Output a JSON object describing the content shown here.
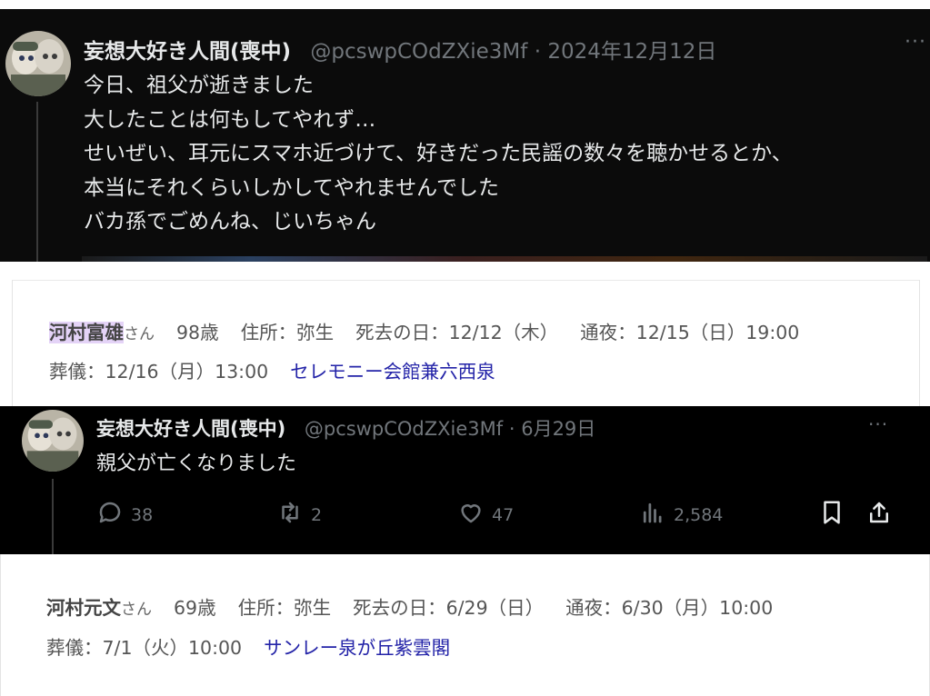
{
  "tweet1": {
    "display_name": "妄想大好き人間(喪中)",
    "handle": "@pcswpCOdZXie3Mf",
    "separator": "·",
    "date": "2024年12月12日",
    "more": "···",
    "lines": [
      "今日、祖父が逝きました",
      "大したことは何もしてやれず…",
      "せいぜい、耳元にスマホ近づけて、好きだった民謡の数々を聴かせるとか、",
      "本当にそれくらいしかしてやれませんでした",
      "バカ孫でごめんね、じいちゃん"
    ]
  },
  "obituary1": {
    "name": "河村富雄",
    "honorific": "さん",
    "age": "98歳",
    "address": "住所：弥生",
    "death_date": "死去の日：12/12（木）",
    "wake": "通夜：12/15（日）19:00",
    "funeral": "葬儀：12/16（月）13:00",
    "venue": "セレモニー会館兼六西泉"
  },
  "tweet2": {
    "display_name": "妄想大好き人間(喪中)",
    "handle": "@pcswpCOdZXie3Mf",
    "separator": "·",
    "date": "6月29日",
    "more": "···",
    "text": "親父が亡くなりました",
    "actions": {
      "replies": "38",
      "retweets": "2",
      "likes": "47",
      "views": "2,584"
    }
  },
  "obituary2": {
    "name": "河村元文",
    "honorific": "さん",
    "age": "69歳",
    "address": "住所：弥生",
    "death_date": "死去の日：6/29（日）",
    "wake": "通夜：6/30（月）10:00",
    "funeral": "葬儀：7/1（火）10:00",
    "venue": "サンレー泉が丘紫雲閣"
  },
  "colors": {
    "tweet_bg": "#000000",
    "text_primary": "#e7e9ea",
    "text_secondary": "#71767b",
    "highlight": "#e4d3f7",
    "venue_link": "#2323a8"
  }
}
